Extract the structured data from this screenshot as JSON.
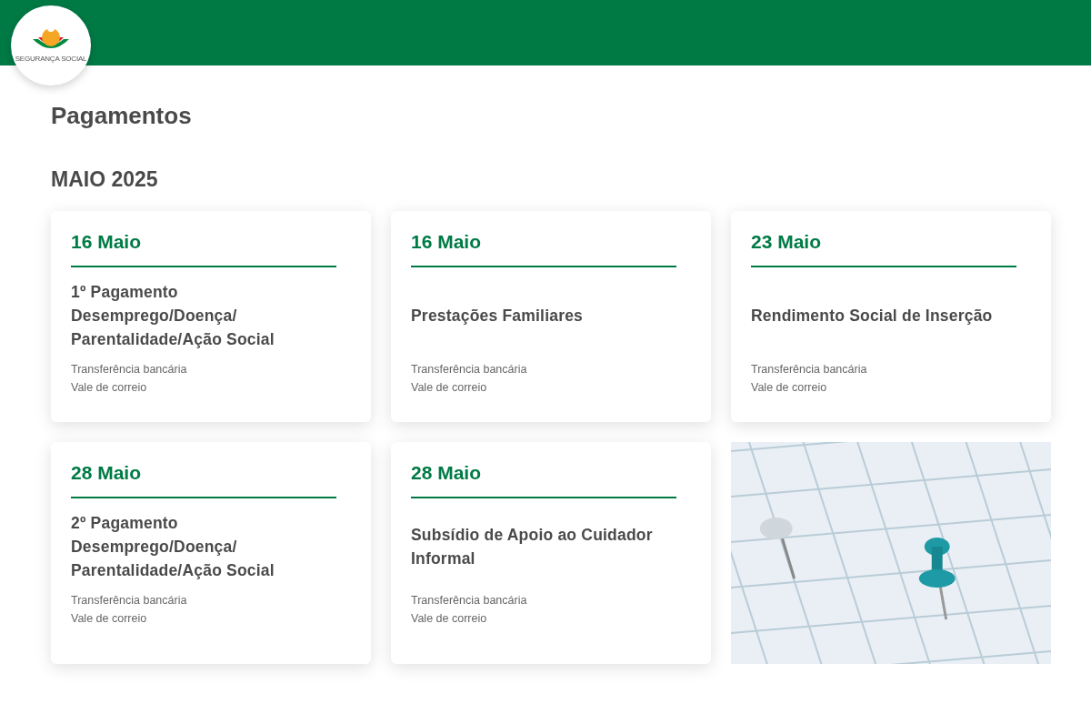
{
  "header": {
    "logo_text": "SEGURANÇA SOCIAL"
  },
  "page_title": "Pagamentos",
  "month": "MAIO 2025",
  "cards": [
    {
      "kind": "payment",
      "date": "16 Maio",
      "title": "1º Pagamento Desemprego/Doença/ Parentalidade/Ação Social",
      "methods": [
        "Transferência bancária",
        "Vale de correio"
      ]
    },
    {
      "kind": "payment",
      "date": "16 Maio",
      "title": "Prestações Familiares",
      "methods": [
        "Transferência bancária",
        "Vale de correio"
      ]
    },
    {
      "kind": "payment",
      "date": "23 Maio",
      "title": "Rendimento Social de Inserção",
      "methods": [
        "Transferência bancária",
        "Vale de correio"
      ]
    },
    {
      "kind": "payment",
      "date": "28 Maio",
      "title": "2º Pagamento Desemprego/Doença/ Parentalidade/Ação Social",
      "methods": [
        "Transferência bancária",
        "Vale de correio"
      ]
    },
    {
      "kind": "payment",
      "date": "28 Maio",
      "title": "Subsídio de Apoio ao Cuidador Informal",
      "methods": [
        "Transferência bancária",
        "Vale de correio"
      ]
    },
    {
      "kind": "photo"
    }
  ]
}
